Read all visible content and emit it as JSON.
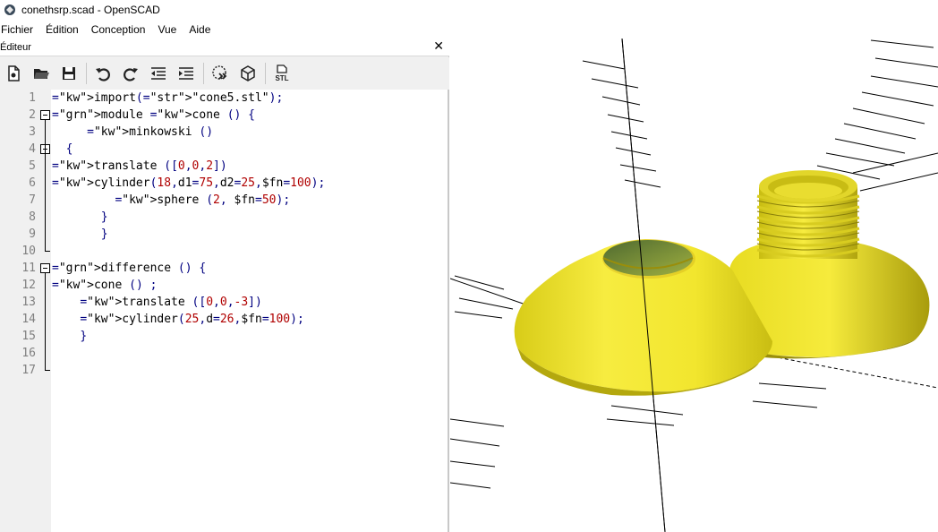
{
  "window": {
    "title": "conethsrp.scad - OpenSCAD",
    "icon": "openscad-app-icon"
  },
  "menu": {
    "items": [
      {
        "label": "Fichier"
      },
      {
        "label": "Édition"
      },
      {
        "label": "Conception"
      },
      {
        "label": "Vue"
      },
      {
        "label": "Aide"
      }
    ]
  },
  "editor": {
    "dock_title": "Éditeur",
    "close_glyph": "✕",
    "toolbar": [
      {
        "icon": "new-file-icon"
      },
      {
        "icon": "open-file-icon"
      },
      {
        "icon": "save-icon"
      },
      {
        "icon": "undo-icon"
      },
      {
        "icon": "redo-icon"
      },
      {
        "icon": "unindent-icon"
      },
      {
        "icon": "indent-icon"
      },
      {
        "icon": "preview-icon"
      },
      {
        "icon": "render-icon"
      },
      {
        "icon": "export-stl-icon",
        "label": "STL"
      }
    ],
    "lines": [
      "import(\"cone5.stl\");",
      "module cone () {",
      "     minkowski ()",
      "  {",
      "translate ([0,0,2])",
      "cylinder(18,d1=75,d2=25,$fn=100);",
      "         sphere (2, $fn=50);",
      "       }",
      "       }",
      "",
      "difference () {",
      "cone () ;",
      "    translate ([0,0,-3])",
      "    cylinder(25,d=26,$fn=100);",
      "    }",
      "",
      ""
    ],
    "line_numbers": [
      "1",
      "2",
      "3",
      "4",
      "5",
      "6",
      "7",
      "8",
      "9",
      "10",
      "11",
      "12",
      "13",
      "14",
      "15",
      "16",
      "17"
    ]
  },
  "viewport": {
    "model_color": "#f2e62e",
    "shadow_color": "#b8ac10",
    "inner_color": "#7a8f30",
    "axis_color": "#000000"
  }
}
